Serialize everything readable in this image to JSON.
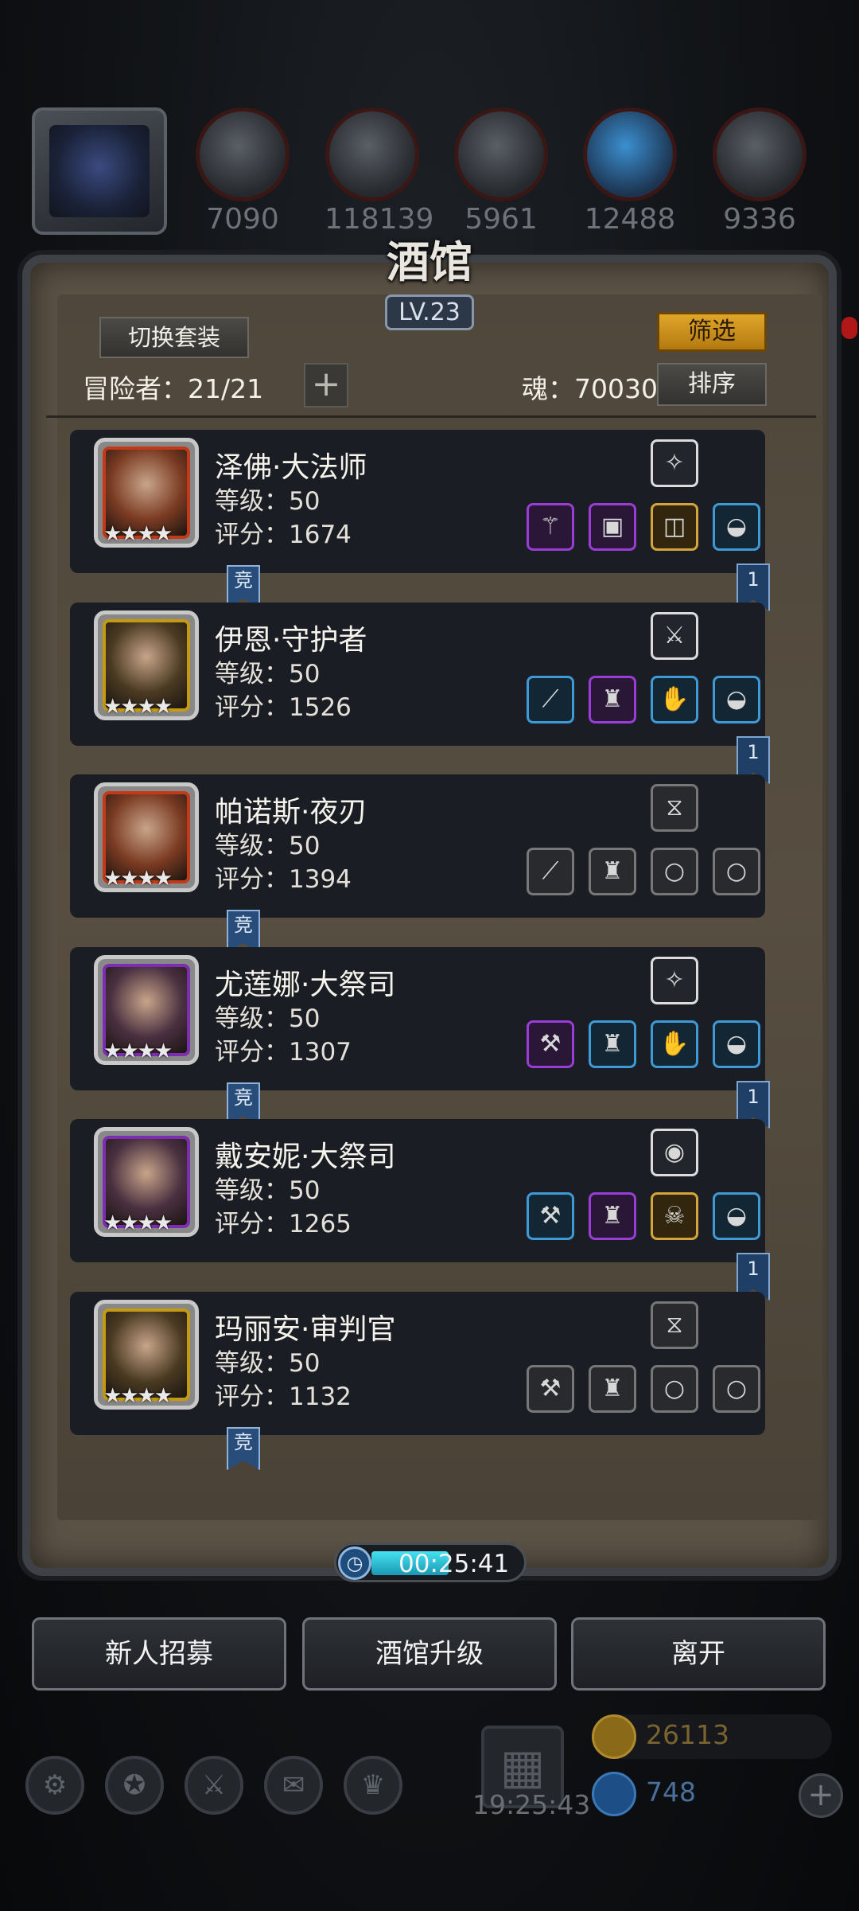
{
  "resources": {
    "avatar_icon": "crystal-artifact-icon",
    "items": [
      {
        "icon": "copper-ore-icon",
        "value": "7090"
      },
      {
        "icon": "wood-plank-icon",
        "value": "118139"
      },
      {
        "icon": "iron-bar-icon",
        "value": "5961"
      },
      {
        "icon": "blue-crystal-icon",
        "value": "12488"
      },
      {
        "icon": "steel-bar-icon",
        "value": "9336"
      }
    ]
  },
  "panel": {
    "title": "酒馆",
    "level": "LV.23",
    "switch_label": "切换套装",
    "filter_label": "筛选",
    "adventurer_label": "冒险者：21/21",
    "add_label": "+",
    "soul_label": "魂：70030",
    "sort_label": "排序"
  },
  "heroes": [
    {
      "name": "泽佛·大法师",
      "level": "等级：50",
      "score": "评分：1674",
      "stars": "★★★★",
      "frame": "red",
      "compete": "竞",
      "rank": "1",
      "accessory": {
        "quality": "white",
        "glyph": "✧"
      },
      "gear": [
        {
          "quality": "purple",
          "glyph": "⚚"
        },
        {
          "quality": "purple",
          "glyph": "▣"
        },
        {
          "quality": "gold",
          "glyph": "◫"
        },
        {
          "quality": "blue",
          "glyph": "◒"
        }
      ]
    },
    {
      "name": "伊恩·守护者",
      "level": "等级：50",
      "score": "评分：1526",
      "stars": "★★★★",
      "frame": "gold",
      "compete": "",
      "rank": "1",
      "accessory": {
        "quality": "white",
        "glyph": "⚔"
      },
      "gear": [
        {
          "quality": "blue",
          "glyph": "⟋"
        },
        {
          "quality": "purple",
          "glyph": "♜"
        },
        {
          "quality": "blue",
          "glyph": "✋"
        },
        {
          "quality": "blue",
          "glyph": "◒"
        }
      ]
    },
    {
      "name": "帕诺斯·夜刃",
      "level": "等级：50",
      "score": "评分：1394",
      "stars": "★★★★",
      "frame": "red",
      "compete": "竞",
      "rank": "",
      "accessory": {
        "quality": "empty",
        "glyph": "⧖"
      },
      "gear": [
        {
          "quality": "empty",
          "glyph": "⟋"
        },
        {
          "quality": "empty",
          "glyph": "♜"
        },
        {
          "quality": "empty",
          "glyph": "○"
        },
        {
          "quality": "empty",
          "glyph": "○"
        }
      ]
    },
    {
      "name": "尤莲娜·大祭司",
      "level": "等级：50",
      "score": "评分：1307",
      "stars": "★★★★",
      "frame": "purple",
      "compete": "竞",
      "rank": "1",
      "accessory": {
        "quality": "white",
        "glyph": "✧"
      },
      "gear": [
        {
          "quality": "purple",
          "glyph": "⚒"
        },
        {
          "quality": "blue",
          "glyph": "♜"
        },
        {
          "quality": "blue",
          "glyph": "✋"
        },
        {
          "quality": "blue",
          "glyph": "◒"
        }
      ]
    },
    {
      "name": "戴安妮·大祭司",
      "level": "等级：50",
      "score": "评分：1265",
      "stars": "★★★★",
      "frame": "purple",
      "compete": "",
      "rank": "1",
      "accessory": {
        "quality": "white",
        "glyph": "◉"
      },
      "gear": [
        {
          "quality": "blue",
          "glyph": "⚒"
        },
        {
          "quality": "purple",
          "glyph": "♜"
        },
        {
          "quality": "gold",
          "glyph": "☠"
        },
        {
          "quality": "blue",
          "glyph": "◒"
        }
      ]
    },
    {
      "name": "玛丽安·审判官",
      "level": "等级：50",
      "score": "评分：1132",
      "stars": "★★★★",
      "frame": "gold",
      "compete": "竞",
      "rank": "",
      "accessory": {
        "quality": "empty",
        "glyph": "⧖"
      },
      "gear": [
        {
          "quality": "empty",
          "glyph": "⚒"
        },
        {
          "quality": "empty",
          "glyph": "♜"
        },
        {
          "quality": "empty",
          "glyph": "○"
        },
        {
          "quality": "empty",
          "glyph": "○"
        }
      ]
    }
  ],
  "timer": {
    "value": "00:25:41",
    "progress": 0.42
  },
  "buttons": {
    "recruit": "新人招募",
    "upgrade": "酒馆升级",
    "leave": "离开"
  },
  "bottom": {
    "nav_icons": [
      "gear-icon",
      "medal-icon",
      "armory-icon",
      "mail-icon",
      "trophy-icon"
    ],
    "clock": "19:25:43",
    "gold": "26113",
    "gems": "748"
  },
  "colors": {
    "accent_gold": "#e0a62a",
    "panel": "#574e41",
    "card": "#1a1d23",
    "compete_blue": "#284d7a"
  }
}
